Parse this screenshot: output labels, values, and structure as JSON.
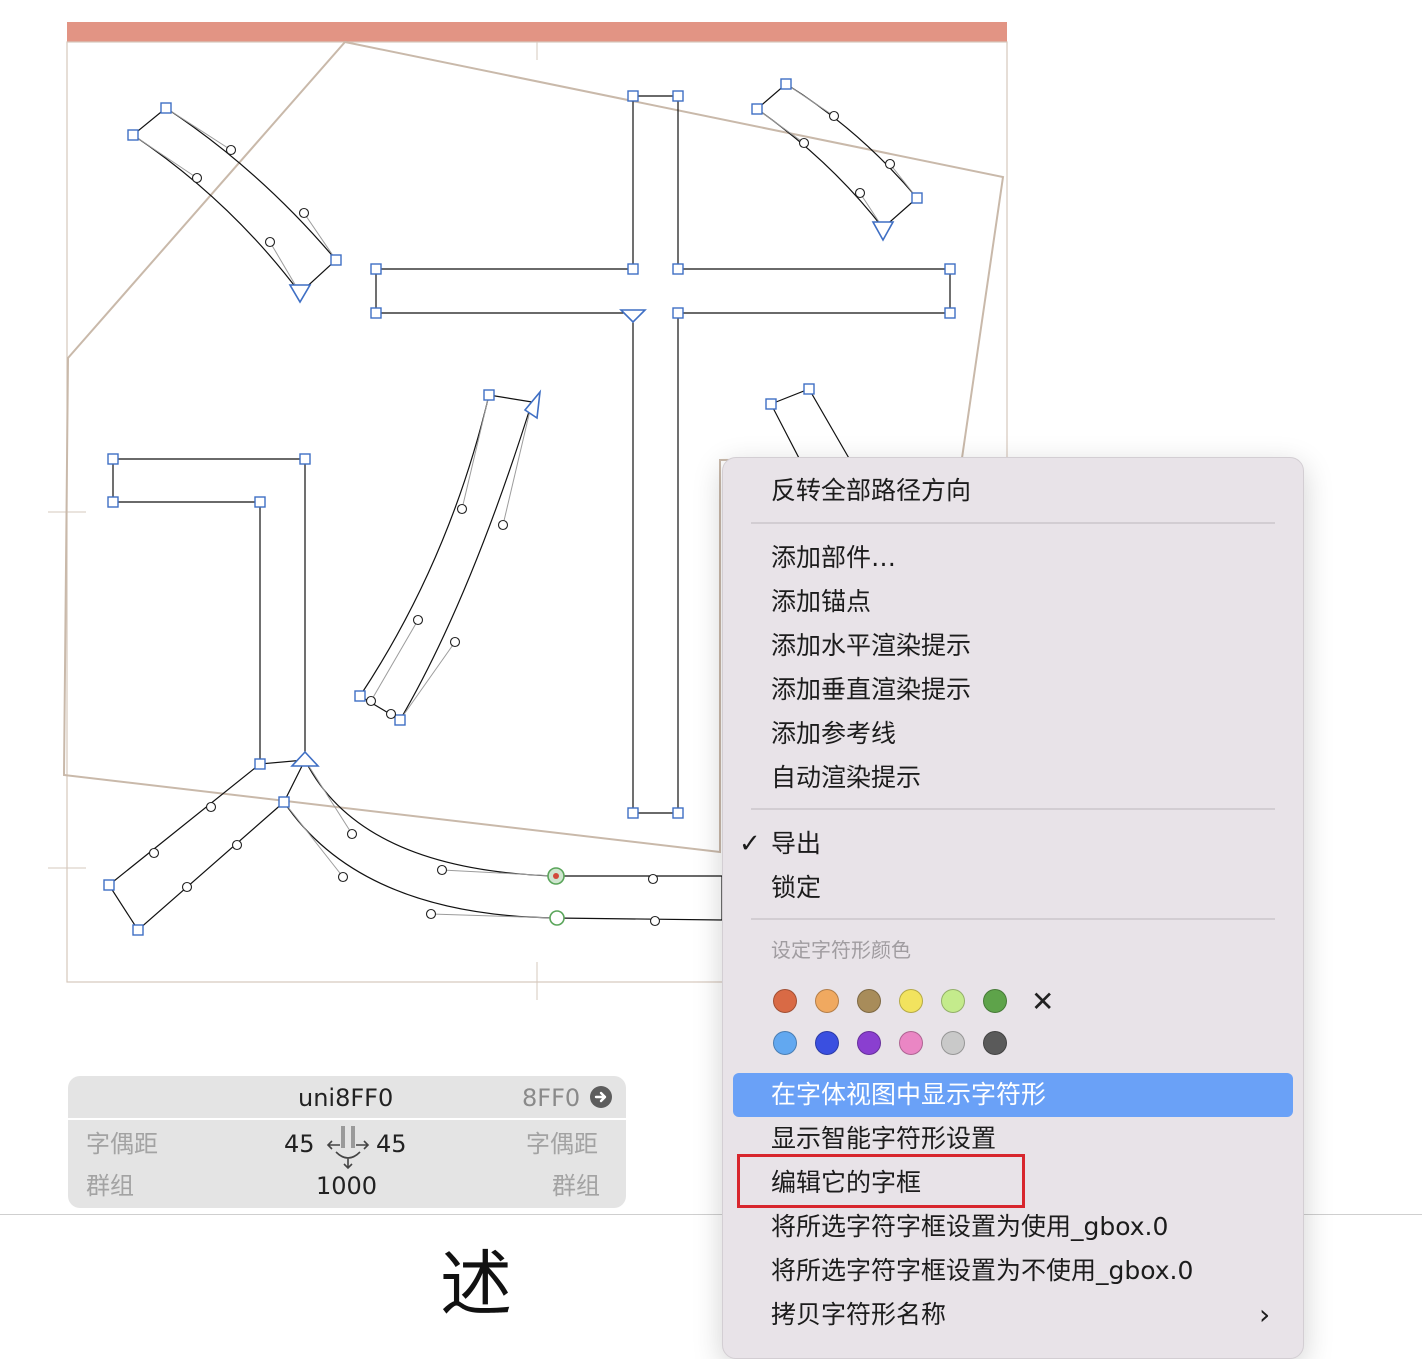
{
  "glyph_panel": {
    "glyph_name": "uni8FF0",
    "unicode": "8FF0",
    "left_kerning_label": "字偶距",
    "right_kerning_label": "字偶距",
    "left_group_label": "群组",
    "right_group_label": "群组",
    "lsb": "45",
    "rsb": "45",
    "width": "1000"
  },
  "preview_glyph": "述",
  "context_menu": {
    "items_group1": [
      "反转全部路径方向"
    ],
    "items_group2": [
      "添加部件…",
      "添加锚点",
      "添加水平渲染提示",
      "添加垂直渲染提示",
      "添加参考线",
      "自动渲染提示"
    ],
    "export_label": "导出",
    "export_checked": true,
    "lock_label": "锁定",
    "color_section_title": "设定字符形颜色",
    "clear_color_symbol": "✕",
    "colors_row1": [
      "#d96a45",
      "#f0a960",
      "#a88c5a",
      "#f2e35e",
      "#c4eb8c",
      "#5ea34a"
    ],
    "colors_row2": [
      "#62a8f0",
      "#3a4fe0",
      "#8a3fd0",
      "#ea86c4",
      "#c9c9c9",
      "#5a5a5a"
    ],
    "highlighted_item": "在字体视图中显示字符形",
    "items_group4": [
      "显示智能字符形设置",
      "编辑它的字框",
      "将所选字符字框设置为使用_gbox.0",
      "将所选字符字框设置为不使用_gbox.0",
      "拷贝字符形名称"
    ]
  },
  "colors": {
    "highlight": "#6aa1f7",
    "annotation_red": "#d8262d",
    "top_bar": "#e29484",
    "node_blue": "#3f6fc4"
  }
}
